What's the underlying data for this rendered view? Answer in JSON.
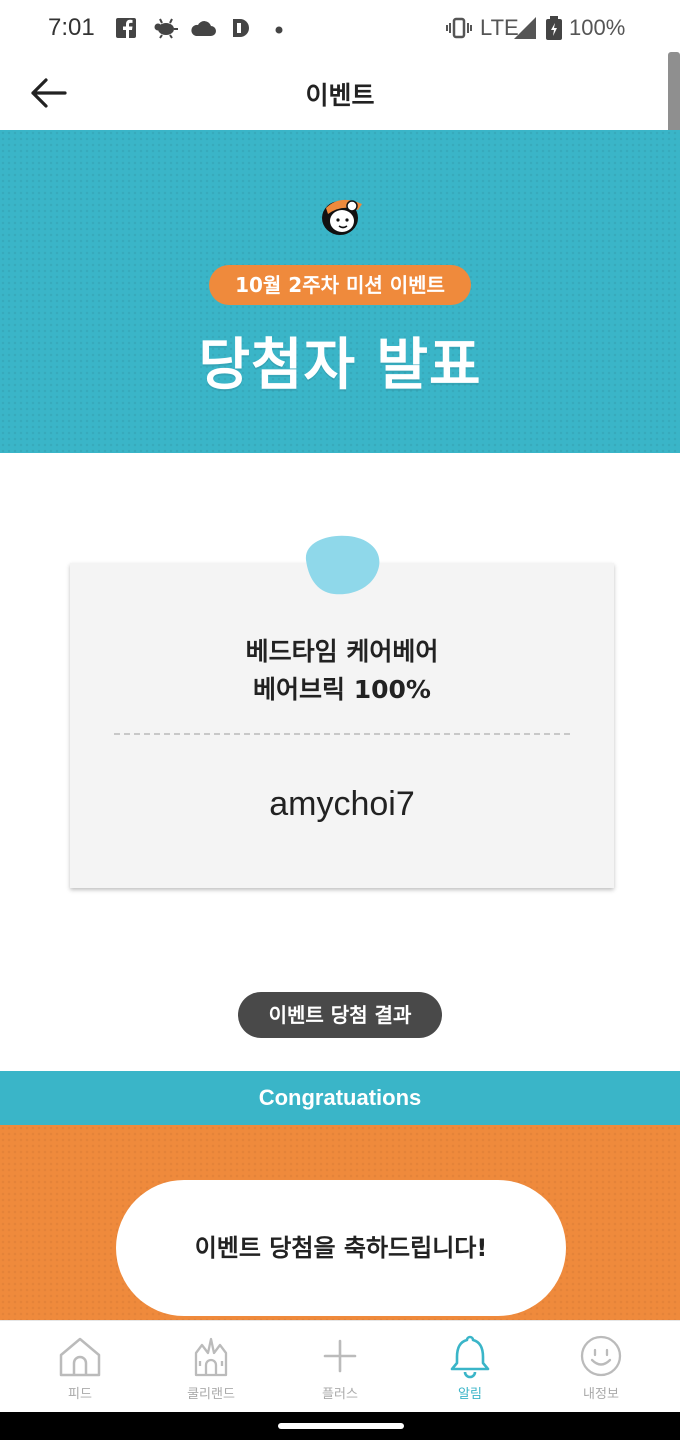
{
  "status_bar": {
    "time": "7:01",
    "network": "LTE",
    "battery": "100%",
    "icons": [
      "facebook-icon",
      "bug-icon",
      "cloud-icon",
      "app-icon",
      "dot-icon",
      "vibrate-icon",
      "signal-icon",
      "battery-icon"
    ]
  },
  "app_bar": {
    "title": "이벤트",
    "back_icon": "arrow-left-icon"
  },
  "hero": {
    "event_label": "10월 2주차 미션 이벤트",
    "headline": "당첨자 발표",
    "mascot_icon": "mascot-icon"
  },
  "prize_card": {
    "prize_line1": "베드타임 케어베어",
    "prize_line2": "베어브릭 100%",
    "winner": "amychoi7"
  },
  "result_button": "이벤트 당첨 결과",
  "congrats": {
    "banner": "Congratuations",
    "message": "이벤트 당첨을 축하드립니다!"
  },
  "bottom_nav": {
    "items": [
      {
        "label": "피드",
        "icon": "home-icon",
        "active": false
      },
      {
        "label": "쿨리랜드",
        "icon": "castle-icon",
        "active": false
      },
      {
        "label": "플러스",
        "icon": "plus-icon",
        "active": false
      },
      {
        "label": "알림",
        "icon": "bell-icon",
        "active": true
      },
      {
        "label": "내정보",
        "icon": "smile-face-icon",
        "active": false
      }
    ]
  },
  "colors": {
    "teal": "#3ab5c8",
    "orange": "#ef8a3c",
    "dark_pill": "#494949",
    "card_bg": "#f4f4f4"
  }
}
